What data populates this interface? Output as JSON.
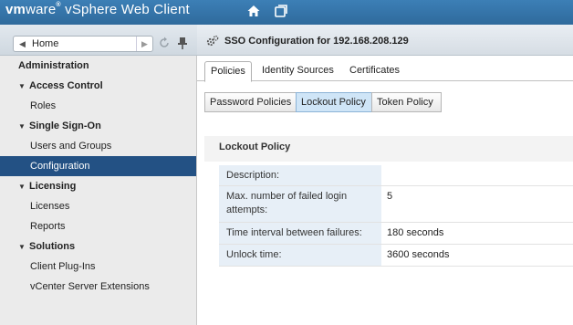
{
  "app": {
    "brand_vm": "vm",
    "brand_ware": "ware",
    "brand_reg": "®",
    "brand_product": " vSphere Web Client"
  },
  "navigator": {
    "home_label": "Home"
  },
  "sidebar": {
    "items": [
      {
        "label": "Administration",
        "kind": "header"
      },
      {
        "label": "Access Control",
        "kind": "section"
      },
      {
        "label": "Roles",
        "kind": "leaf"
      },
      {
        "label": "Single Sign-On",
        "kind": "section"
      },
      {
        "label": "Users and Groups",
        "kind": "leaf"
      },
      {
        "label": "Configuration",
        "kind": "leaf",
        "selected": true
      },
      {
        "label": "Licensing",
        "kind": "section"
      },
      {
        "label": "Licenses",
        "kind": "leaf"
      },
      {
        "label": "Reports",
        "kind": "leaf"
      },
      {
        "label": "Solutions",
        "kind": "section"
      },
      {
        "label": "Client Plug-Ins",
        "kind": "leaf"
      },
      {
        "label": "vCenter Server Extensions",
        "kind": "leaf"
      }
    ]
  },
  "main": {
    "title": "SSO Configuration for 192.168.208.129",
    "tabs": [
      {
        "label": "Policies",
        "active": true
      },
      {
        "label": "Identity Sources"
      },
      {
        "label": "Certificates"
      }
    ],
    "subtabs": [
      {
        "label": "Password Policies"
      },
      {
        "label": "Lockout Policy",
        "active": true
      },
      {
        "label": "Token Policy"
      }
    ],
    "panel_title": "Lockout Policy",
    "properties": [
      {
        "key": "Description:",
        "value": ""
      },
      {
        "key": "Max. number of failed login attempts:",
        "value": "5"
      },
      {
        "key": "Time interval between failures:",
        "value": "180 seconds"
      },
      {
        "key": "Unlock time:",
        "value": "3600 seconds"
      }
    ]
  },
  "colors": {
    "header_blue": "#2f6a9c",
    "selected_nav": "#235184",
    "active_subtab": "#cfe5f7",
    "property_key_bg": "#e7eff7"
  },
  "icons": {
    "home": "home-icon",
    "history": "history-icon",
    "refresh": "refresh-icon",
    "pin": "pin-icon",
    "config": "gear-icon"
  }
}
